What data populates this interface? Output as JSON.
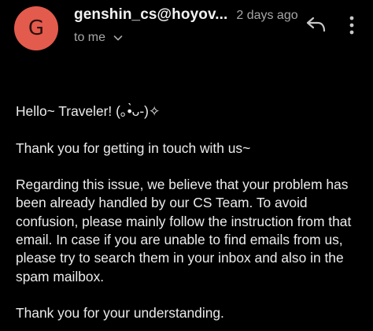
{
  "accent_color": "#e35b4d",
  "header": {
    "avatar_letter": "G",
    "sender": "genshin_cs@hoyov...",
    "time": "2 days ago",
    "recipient": "to me",
    "icons": {
      "recipient_toggle": "chevron-down-icon",
      "reply": "reply-icon",
      "more": "more-vert-icon"
    }
  },
  "message": {
    "greeting": "Hello~ Traveler! (｡•̀ᴗ-)✧",
    "thanks": "Thank you for getting in touch with us~",
    "body": "Regarding this issue, we believe that your problem has been already handled by our CS Team. To avoid confusion, please mainly follow the instruction from that email. In case if you are unable to find emails from us, please try to search them in your inbox and also in the spam mailbox.",
    "closing": "Thank you for your understanding."
  }
}
